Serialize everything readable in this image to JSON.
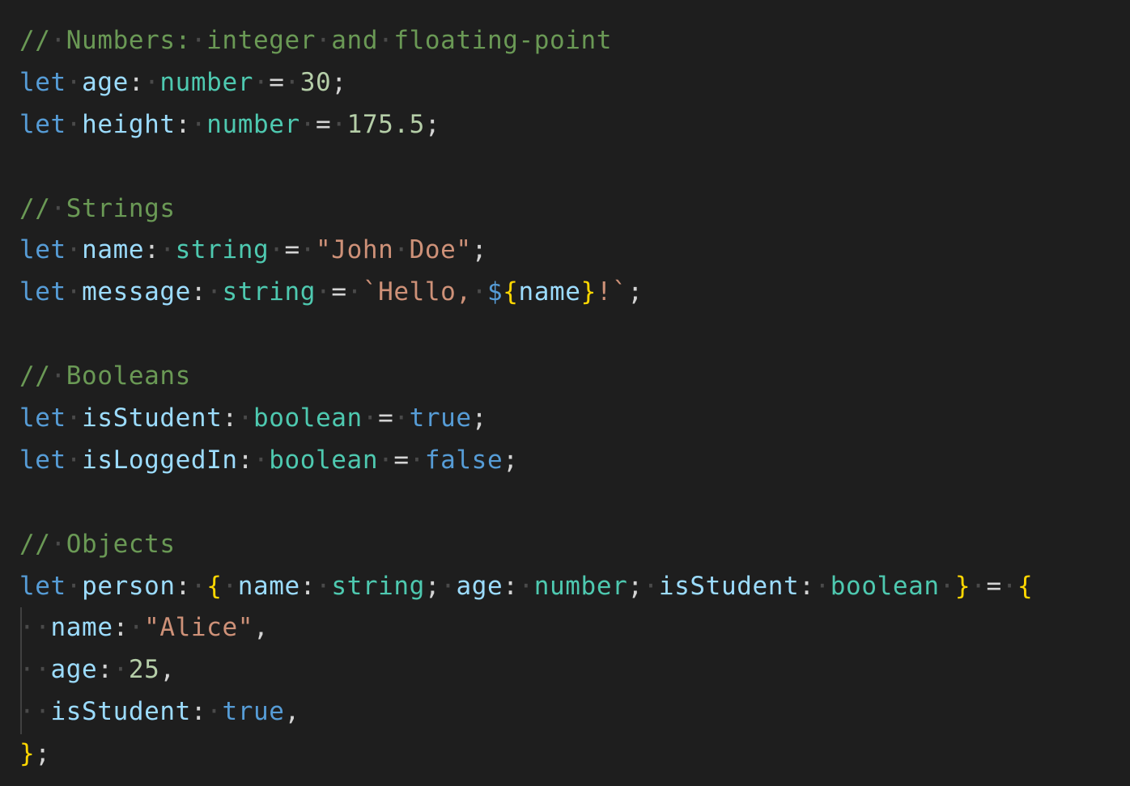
{
  "editor": {
    "theme": {
      "background": "#1e1e1e",
      "keyword": "#569cd6",
      "variable": "#9cdcfe",
      "type": "#4ec9b0",
      "number": "#b5cea8",
      "string": "#ce9178",
      "comment": "#6a9955",
      "punctuation": "#d4d4d4",
      "bracket": "#ffd700",
      "whitespace_marker": "#4a4a4a",
      "indent_guide": "#404040"
    },
    "lines": [
      [
        [
          "comment",
          "//"
        ],
        [
          "ws",
          "·"
        ],
        [
          "comment",
          "Numbers:"
        ],
        [
          "ws",
          "·"
        ],
        [
          "comment",
          "integer"
        ],
        [
          "ws",
          "·"
        ],
        [
          "comment",
          "and"
        ],
        [
          "ws",
          "·"
        ],
        [
          "comment",
          "floating-point"
        ]
      ],
      [
        [
          "keyword",
          "let"
        ],
        [
          "ws",
          "·"
        ],
        [
          "variable",
          "age"
        ],
        [
          "punct",
          ":"
        ],
        [
          "ws",
          "·"
        ],
        [
          "type",
          "number"
        ],
        [
          "ws",
          "·"
        ],
        [
          "punct",
          "="
        ],
        [
          "ws",
          "·"
        ],
        [
          "number",
          "30"
        ],
        [
          "punct",
          ";"
        ]
      ],
      [
        [
          "keyword",
          "let"
        ],
        [
          "ws",
          "·"
        ],
        [
          "variable",
          "height"
        ],
        [
          "punct",
          ":"
        ],
        [
          "ws",
          "·"
        ],
        [
          "type",
          "number"
        ],
        [
          "ws",
          "·"
        ],
        [
          "punct",
          "="
        ],
        [
          "ws",
          "·"
        ],
        [
          "number",
          "175.5"
        ],
        [
          "punct",
          ";"
        ]
      ],
      [],
      [
        [
          "comment",
          "//"
        ],
        [
          "ws",
          "·"
        ],
        [
          "comment",
          "Strings"
        ]
      ],
      [
        [
          "keyword",
          "let"
        ],
        [
          "ws",
          "·"
        ],
        [
          "variable",
          "name"
        ],
        [
          "punct",
          ":"
        ],
        [
          "ws",
          "·"
        ],
        [
          "type",
          "string"
        ],
        [
          "ws",
          "·"
        ],
        [
          "punct",
          "="
        ],
        [
          "ws",
          "·"
        ],
        [
          "string",
          "\"John"
        ],
        [
          "ws",
          "·"
        ],
        [
          "string",
          "Doe\""
        ],
        [
          "punct",
          ";"
        ]
      ],
      [
        [
          "keyword",
          "let"
        ],
        [
          "ws",
          "·"
        ],
        [
          "variable",
          "message"
        ],
        [
          "punct",
          ":"
        ],
        [
          "ws",
          "·"
        ],
        [
          "type",
          "string"
        ],
        [
          "ws",
          "·"
        ],
        [
          "punct",
          "="
        ],
        [
          "ws",
          "·"
        ],
        [
          "string",
          "`Hello,"
        ],
        [
          "ws",
          "·"
        ],
        [
          "keyword",
          "$"
        ],
        [
          "bracket",
          "{"
        ],
        [
          "variable",
          "name"
        ],
        [
          "bracket",
          "}"
        ],
        [
          "string",
          "!`"
        ],
        [
          "punct",
          ";"
        ]
      ],
      [],
      [
        [
          "comment",
          "//"
        ],
        [
          "ws",
          "·"
        ],
        [
          "comment",
          "Booleans"
        ]
      ],
      [
        [
          "keyword",
          "let"
        ],
        [
          "ws",
          "·"
        ],
        [
          "variable",
          "isStudent"
        ],
        [
          "punct",
          ":"
        ],
        [
          "ws",
          "·"
        ],
        [
          "type",
          "boolean"
        ],
        [
          "ws",
          "·"
        ],
        [
          "punct",
          "="
        ],
        [
          "ws",
          "·"
        ],
        [
          "keyword",
          "true"
        ],
        [
          "punct",
          ";"
        ]
      ],
      [
        [
          "keyword",
          "let"
        ],
        [
          "ws",
          "·"
        ],
        [
          "variable",
          "isLoggedIn"
        ],
        [
          "punct",
          ":"
        ],
        [
          "ws",
          "·"
        ],
        [
          "type",
          "boolean"
        ],
        [
          "ws",
          "·"
        ],
        [
          "punct",
          "="
        ],
        [
          "ws",
          "·"
        ],
        [
          "keyword",
          "false"
        ],
        [
          "punct",
          ";"
        ]
      ],
      [],
      [
        [
          "comment",
          "//"
        ],
        [
          "ws",
          "·"
        ],
        [
          "comment",
          "Objects"
        ]
      ],
      [
        [
          "keyword",
          "let"
        ],
        [
          "ws",
          "·"
        ],
        [
          "variable",
          "person"
        ],
        [
          "punct",
          ":"
        ],
        [
          "ws",
          "·"
        ],
        [
          "bracket",
          "{"
        ],
        [
          "ws",
          "·"
        ],
        [
          "variable",
          "name"
        ],
        [
          "punct",
          ":"
        ],
        [
          "ws",
          "·"
        ],
        [
          "type",
          "string"
        ],
        [
          "punct",
          ";"
        ],
        [
          "ws",
          "·"
        ],
        [
          "variable",
          "age"
        ],
        [
          "punct",
          ":"
        ],
        [
          "ws",
          "·"
        ],
        [
          "type",
          "number"
        ],
        [
          "punct",
          ";"
        ],
        [
          "ws",
          "·"
        ],
        [
          "variable",
          "isStudent"
        ],
        [
          "punct",
          ":"
        ],
        [
          "ws",
          "·"
        ],
        [
          "type",
          "boolean"
        ],
        [
          "ws",
          "·"
        ],
        [
          "bracket",
          "}"
        ],
        [
          "ws",
          "·"
        ],
        [
          "punct",
          "="
        ],
        [
          "ws",
          "·"
        ],
        [
          "bracket",
          "{"
        ]
      ],
      [
        [
          "ws",
          "··"
        ],
        [
          "variable",
          "name"
        ],
        [
          "punct",
          ":"
        ],
        [
          "ws",
          "·"
        ],
        [
          "string",
          "\"Alice\""
        ],
        [
          "punct",
          ","
        ]
      ],
      [
        [
          "ws",
          "··"
        ],
        [
          "variable",
          "age"
        ],
        [
          "punct",
          ":"
        ],
        [
          "ws",
          "·"
        ],
        [
          "number",
          "25"
        ],
        [
          "punct",
          ","
        ]
      ],
      [
        [
          "ws",
          "··"
        ],
        [
          "variable",
          "isStudent"
        ],
        [
          "punct",
          ":"
        ],
        [
          "ws",
          "·"
        ],
        [
          "keyword",
          "true"
        ],
        [
          "punct",
          ","
        ]
      ],
      [
        [
          "bracket",
          "}"
        ],
        [
          "punct",
          ";"
        ]
      ]
    ]
  }
}
